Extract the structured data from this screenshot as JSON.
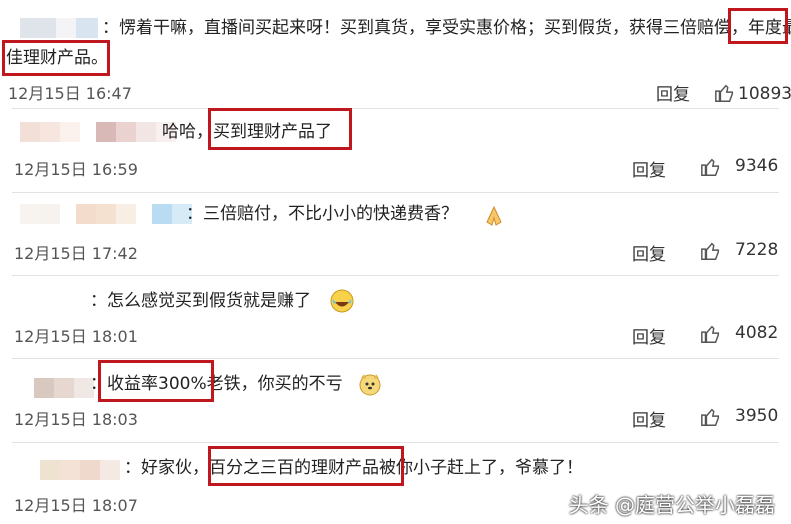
{
  "comments": [
    {
      "prefix": "：",
      "text_a": "愣着干嘛，直播间买起来呀！买到真货，享受实惠价格；买到假货，获得三倍赔偿，",
      "highlight_a": "年度最",
      "highlight_b": "佳理财产品。",
      "time": "12月15日 16:47",
      "reply": "回复",
      "likes": "10893"
    },
    {
      "prefix": "哈哈，",
      "highlight": "买到理财产品了",
      "time": "12月15日 16:59",
      "reply": "回复",
      "likes": "9346"
    },
    {
      "text": "：三倍赔付，不比小小的快递费香？",
      "time": "12月15日 17:42",
      "reply": "回复",
      "likes": "7228"
    },
    {
      "text": "：怎么感觉买到假货就是赚了",
      "time": "12月15日 18:01",
      "reply": "回复",
      "likes": "4082"
    },
    {
      "prefix": "：",
      "highlight": "收益率300%",
      "suffix": "老铁，你买的不亏",
      "time": "12月15日 18:03",
      "reply": "回复",
      "likes": "3950"
    },
    {
      "prefix": "：好家伙，",
      "highlight": "百分之三百的理财产品",
      "suffix": "被你小子赶上了，爷慕了！",
      "time": "12月15日 18:07"
    }
  ],
  "watermark": "头条 @庭营公举小磊磊",
  "icons": {
    "like": "thumbs-up-icon"
  }
}
